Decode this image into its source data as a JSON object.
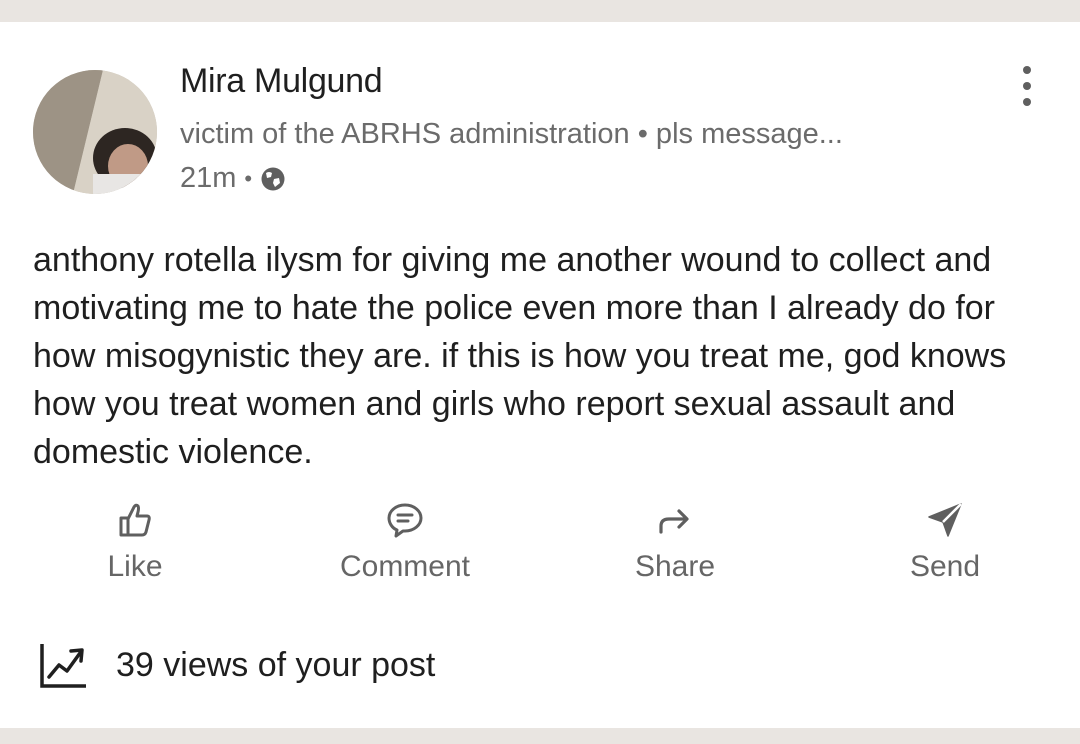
{
  "author": {
    "name": "Mira Mulgund",
    "headline": "victim of the ABRHS administration • pls message...",
    "time": "21m",
    "separator": "•",
    "visibility_icon": "globe-icon"
  },
  "menu_icon": "more-vertical-icon",
  "post": {
    "text": "anthony rotella ilysm for giving me another wound to collect and motivating me to hate the police even more than I already do for how misogynistic they are. if this is how you treat me, god knows how you treat women and girls who report sexual assault and domestic violence."
  },
  "actions": [
    {
      "label": "Like",
      "icon": "thumbs-up-icon"
    },
    {
      "label": "Comment",
      "icon": "comment-icon"
    },
    {
      "label": "Share",
      "icon": "share-arrow-icon"
    },
    {
      "label": "Send",
      "icon": "send-icon"
    }
  ],
  "analytics": {
    "icon": "trending-chart-icon",
    "text": "39 views of your post"
  },
  "colors": {
    "background": "#e9e5e1",
    "card": "#ffffff",
    "primary_text": "#1f1f1f",
    "secondary_text": "#6b6b6b",
    "action_text": "#666666"
  }
}
